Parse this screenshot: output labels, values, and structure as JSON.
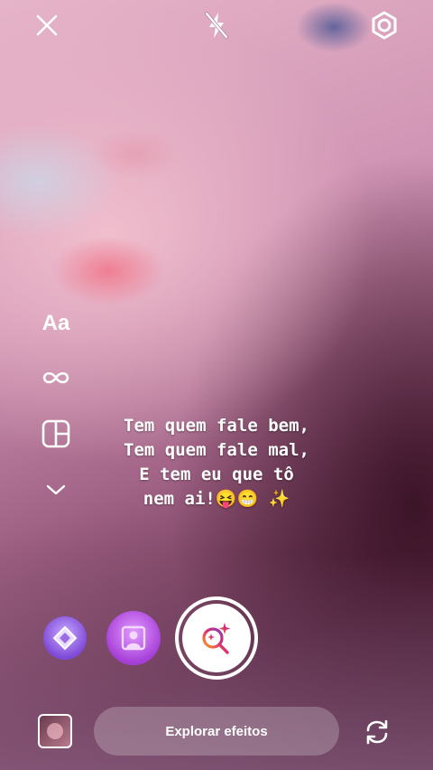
{
  "topbar": {
    "close_icon": "close-icon",
    "flash_icon": "flash-off-icon",
    "settings_icon": "settings-gear-icon"
  },
  "side_tools": {
    "text_label": "Aa",
    "boomerang_icon": "infinity-icon",
    "layout_icon": "layout-grid-icon",
    "more_icon": "chevron-down-icon"
  },
  "caption": {
    "lines": [
      "Tem quem fale bem,",
      "Tem quem fale mal,",
      "E tem eu que tô",
      "nem ai!😝😁 ✨"
    ]
  },
  "effects": {
    "items": [
      {
        "icon": "diamond-effect-icon"
      },
      {
        "icon": "portrait-effect-icon"
      }
    ],
    "capture_icon": "search-sparkle-icon"
  },
  "bottombar": {
    "gallery_icon": "gallery-thumbnail",
    "explore_label": "Explorar efeitos",
    "flip_icon": "camera-flip-icon"
  },
  "colors": {
    "accent_gradient_start": "#f5a623",
    "accent_gradient_end": "#c13584"
  }
}
